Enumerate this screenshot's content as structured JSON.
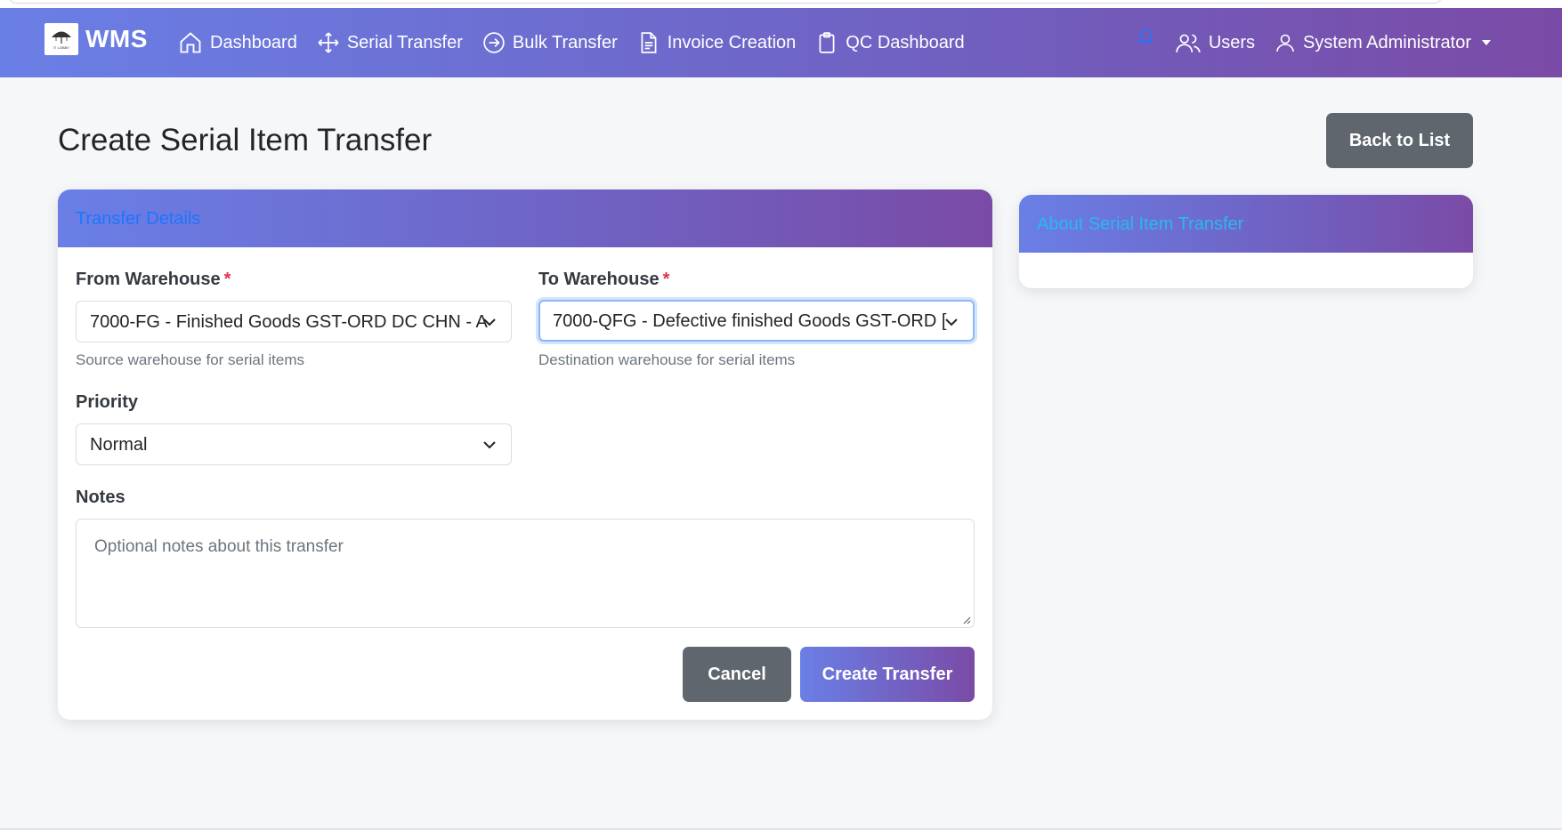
{
  "navbar": {
    "brand": "WMS",
    "logo_text": "IT LOBBY",
    "items": [
      {
        "label": "Dashboard",
        "icon": "home-icon"
      },
      {
        "label": "Serial Transfer",
        "icon": "move-arrows-icon"
      },
      {
        "label": "Bulk Transfer",
        "icon": "arrow-circle-right-icon"
      },
      {
        "label": "Invoice Creation",
        "icon": "document-icon"
      },
      {
        "label": "QC Dashboard",
        "icon": "clipboard-icon"
      }
    ],
    "right": {
      "notification_icon": "bell-icon",
      "users_label": "Users",
      "user_label": "System Administrator"
    },
    "gradient": [
      "#6a7fe6",
      "#7a4ba6"
    ]
  },
  "page": {
    "title": "Create Serial Item Transfer",
    "back_button": "Back to List"
  },
  "form": {
    "card_title": "Transfer Details",
    "from_warehouse": {
      "label": "From Warehouse",
      "required_mark": "*",
      "value": "7000-FG - Finished Goods GST-ORD DC CHN - A",
      "help": "Source warehouse for serial items"
    },
    "to_warehouse": {
      "label": "To Warehouse",
      "required_mark": "*",
      "value": "7000-QFG - Defective finished Goods GST-ORD [",
      "help": "Destination warehouse for serial items"
    },
    "priority": {
      "label": "Priority",
      "value": "Normal"
    },
    "notes": {
      "label": "Notes",
      "placeholder": "Optional notes about this transfer"
    },
    "cancel_button": "Cancel",
    "submit_button": "Create Transfer"
  },
  "side_card": {
    "title": "About Serial Item Transfer"
  }
}
